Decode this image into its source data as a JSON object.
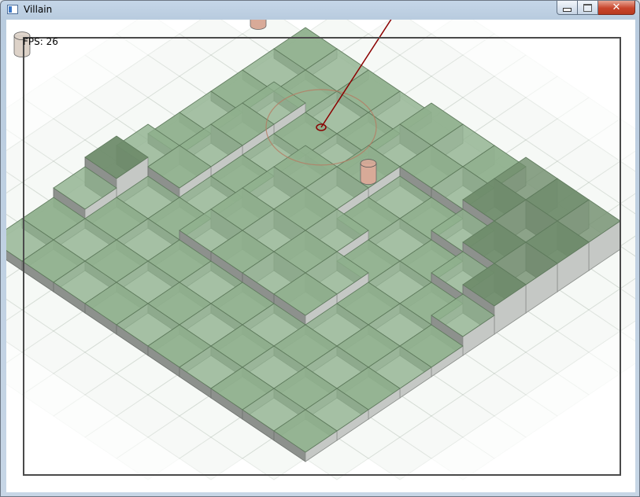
{
  "window": {
    "title": "Villain",
    "minimize_label": "minimize",
    "maximize_label": "maximize",
    "close_glyph": "✕"
  },
  "hud": {
    "fps": "FPS: 26"
  },
  "scene": {
    "board_size": 10,
    "heights": [
      [
        1,
        1,
        1,
        1,
        2,
        2,
        2,
        3,
        3,
        3
      ],
      [
        1,
        1,
        1,
        1,
        2,
        2,
        2,
        3,
        3,
        3
      ],
      [
        1,
        2,
        1,
        1,
        2,
        1,
        1,
        2,
        3,
        3
      ],
      [
        1,
        2,
        1,
        2,
        2,
        1,
        1,
        1,
        2,
        3
      ],
      [
        1,
        2,
        1,
        2,
        2,
        2,
        1,
        1,
        1,
        2
      ],
      [
        2,
        2,
        1,
        2,
        2,
        2,
        2,
        1,
        1,
        1
      ],
      [
        3,
        1,
        1,
        2,
        2,
        2,
        2,
        1,
        1,
        1
      ],
      [
        2,
        1,
        1,
        1,
        1,
        1,
        1,
        1,
        1,
        1
      ],
      [
        1,
        1,
        1,
        1,
        1,
        1,
        1,
        1,
        1,
        1
      ],
      [
        1,
        1,
        1,
        1,
        1,
        1,
        1,
        1,
        1,
        1
      ]
    ],
    "characters": [
      {
        "name": "player",
        "col": 1.6,
        "row": -1.2,
        "color": "#dde2de"
      },
      {
        "name": "villain-1",
        "col": -0.5,
        "row": 1.0,
        "color": "#d8aa98"
      },
      {
        "name": "villain-2",
        "col": 4.9,
        "row": 2.9,
        "color": "#d8aa98"
      },
      {
        "name": "villain-3",
        "col": -3.6,
        "row": 5.4,
        "color": "#ddd2c8"
      }
    ],
    "target": {
      "col": 2.6,
      "row": 2.1
    },
    "colors": {
      "tile_top": "#8fb08d",
      "tile_dark": "#6f8c6c",
      "side_left": "#8d918d",
      "side_right": "#c5c8c5",
      "aim_line": "#8b0000",
      "range_circle": "#b77b62"
    }
  }
}
